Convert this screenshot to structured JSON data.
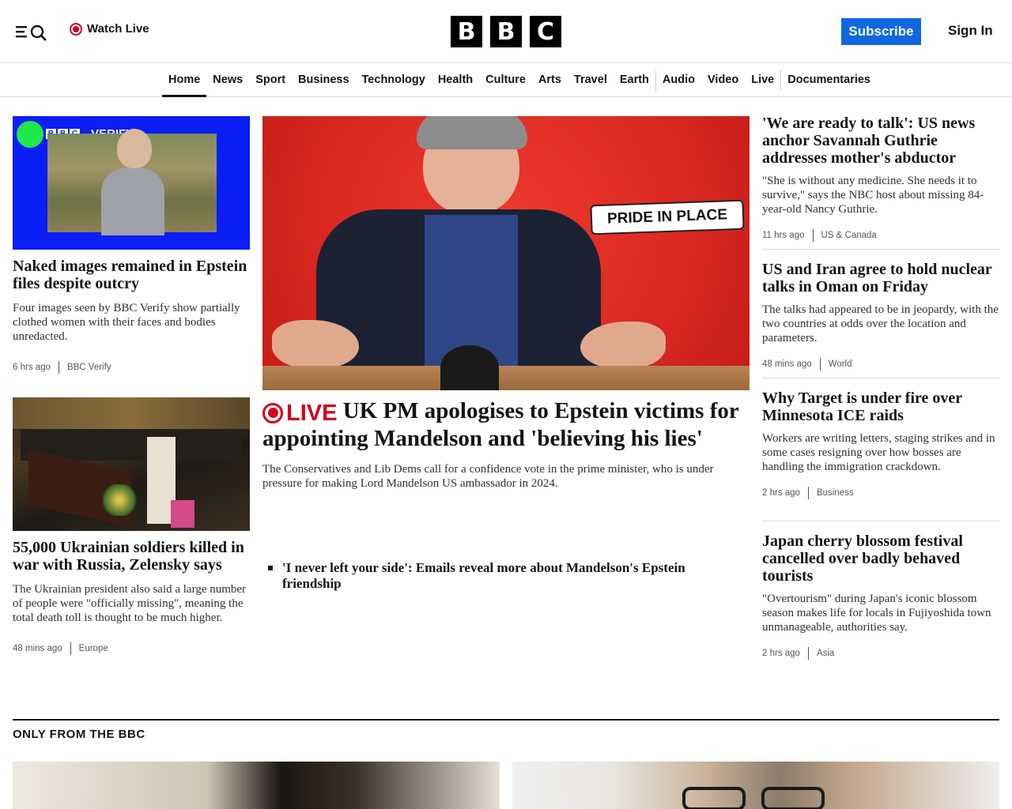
{
  "header": {
    "watch_live": "Watch Live",
    "logo": [
      "B",
      "B",
      "C"
    ],
    "subscribe": "Subscribe",
    "sign_in": "Sign In",
    "menu_icon": "menu-icon",
    "search_icon": "search-icon",
    "accent_color": "#0f68e0",
    "live_color": "#d4001f"
  },
  "nav": {
    "items": [
      "Home",
      "News",
      "Sport",
      "Business",
      "Technology",
      "Health",
      "Culture",
      "Arts",
      "Travel",
      "Earth",
      "Audio",
      "Video",
      "Live",
      "Documentaries"
    ],
    "active": "Home"
  },
  "left": {
    "a1": {
      "image_badge": "VERIFY",
      "headline": "Naked images remained in Epstein files despite outcry",
      "summary": "Four images seen by BBC Verify show partially clothed women with their faces and bodies unredacted.",
      "time": "6 hrs ago",
      "section": "BBC Verify"
    },
    "a2": {
      "headline": "55,000 Ukrainian soldiers killed in war with Russia, Zelensky says",
      "summary": "The Ukrainian president also said a large number of people were \"officially missing\", meaning the total death toll is thought to be much higher.",
      "time": "48 mins ago",
      "section": "Europe"
    }
  },
  "center": {
    "sign_text": "PRIDE IN PLACE",
    "live_label": "LIVE",
    "headline": "UK PM apologises to Epstein victims for appointing Mandelson and 'believing his lies'",
    "summary": "The Conservatives and Lib Dems call for a confidence vote in the prime minister, who is under pressure for making Lord Mandelson US ambassador in 2024.",
    "related": "'I never left your side': Emails reveal more about Mandelson's Epstein friendship"
  },
  "right": {
    "r1": {
      "headline": "'We are ready to talk': US news anchor Savannah Guthrie addresses mother's abductor",
      "summary": "\"She is without any medicine. She needs it to survive,\" says the NBC host about missing 84-year-old Nancy Guthrie.",
      "time": "11 hrs ago",
      "section": "US & Canada"
    },
    "r2": {
      "headline": "US and Iran agree to hold nuclear talks in Oman on Friday",
      "summary": "The talks had appeared to be in jeopardy, with the two countries at odds over the location and parameters.",
      "time": "48 mins ago",
      "section": "World"
    },
    "r3": {
      "headline": "Why Target is under fire over Minnesota ICE raids",
      "summary": "Workers are writing letters, staging strikes and in some cases resigning over how bosses are handling the immigration crackdown.",
      "time": "2 hrs ago",
      "section": "Business"
    },
    "r4": {
      "headline": "Japan cherry blossom festival cancelled over badly behaved tourists",
      "summary": "\"Overtourism\" during Japan's iconic blossom season makes life for locals in Fujiyoshida town unmanageable, authorities say.",
      "time": "2 hrs ago",
      "section": "Asia"
    }
  },
  "section": {
    "title": "ONLY FROM THE BBC"
  }
}
